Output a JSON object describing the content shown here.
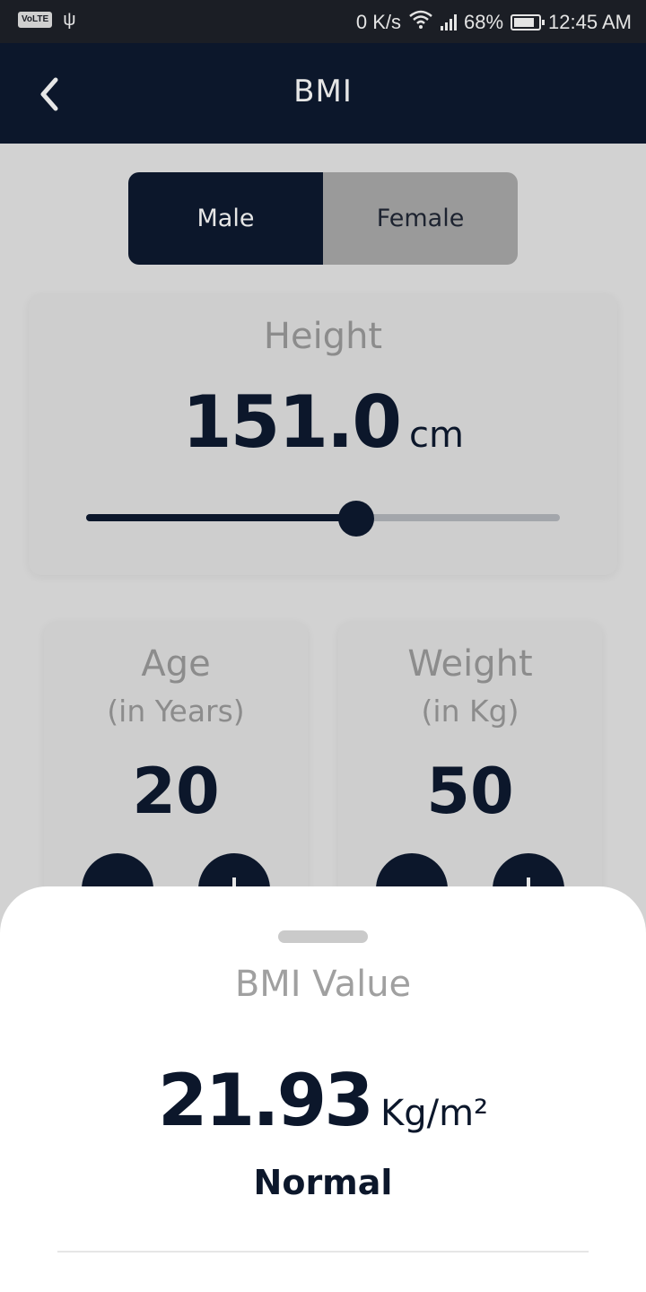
{
  "status_bar": {
    "left_badge": "VoLTE",
    "usb_icon": "usb-icon",
    "net_speed": "0 K/s",
    "battery_percent": "68%",
    "time": "12:45 AM"
  },
  "app_bar": {
    "title": "BMI",
    "back_icon": "chevron-left-icon"
  },
  "gender": {
    "options": [
      "Male",
      "Female"
    ],
    "selected": "Male"
  },
  "height": {
    "label": "Height",
    "value": "151.0",
    "unit": "cm",
    "slider_fraction": 0.57
  },
  "age": {
    "label": "Age",
    "sub_label": "(in Years)",
    "value": "20"
  },
  "weight": {
    "label": "Weight",
    "sub_label": "(in Kg)",
    "value": "50"
  },
  "result": {
    "title": "BMI Value",
    "value": "21.93",
    "unit": "Kg/m²",
    "status": "Normal"
  },
  "colors": {
    "primary": "#0c172b",
    "inactive_toggle": "#9a9a9a",
    "card": "#cecece",
    "background": "#d2d2d2",
    "muted_text": "#8c8c8c"
  }
}
